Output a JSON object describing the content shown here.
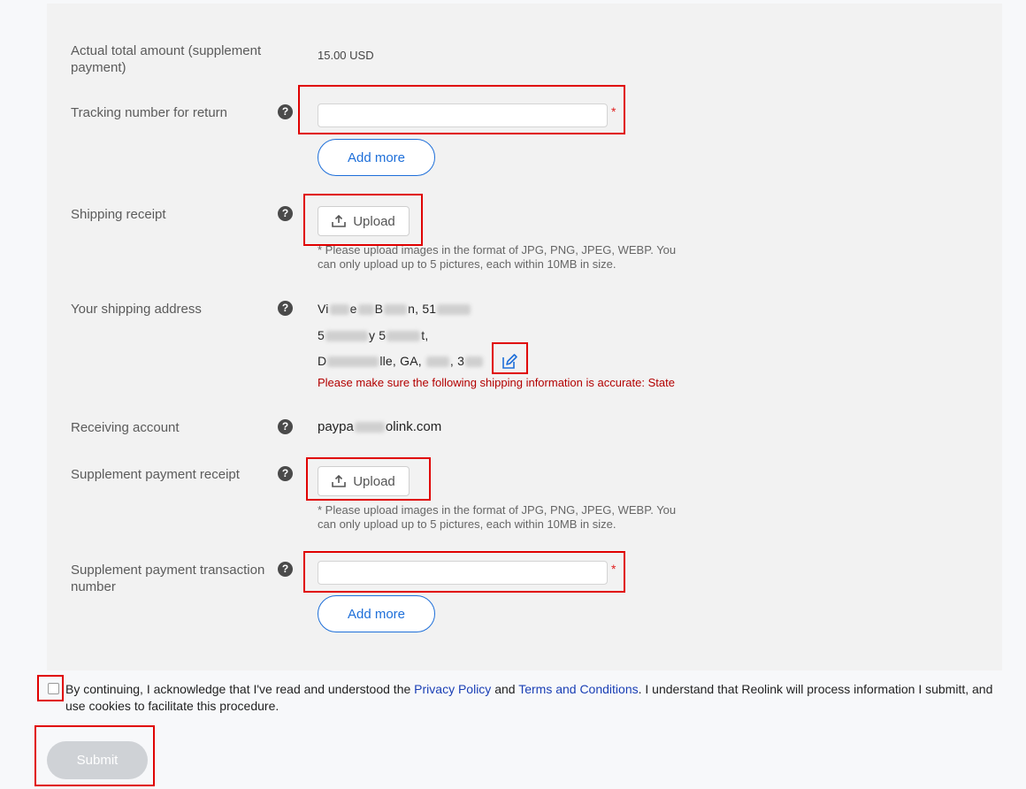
{
  "fields": {
    "actual_total": {
      "label": "Actual total amount (supplement payment)",
      "value": "15.00 USD"
    },
    "tracking": {
      "label": "Tracking number for return",
      "value": "",
      "add_more": "Add more"
    },
    "shipping_receipt": {
      "label": "Shipping receipt",
      "upload": "Upload",
      "hint": "* Please upload images in the format of JPG, PNG, JPEG, WEBP. You can only upload up to 5 pictures, each within 10MB in size."
    },
    "shipping_address": {
      "label": "Your shipping address",
      "line1_a": "Vi",
      "line1_b": "e",
      "line1_c": "B",
      "line1_d": "n, 51",
      "line2_a": "5",
      "line2_b": "y 5",
      "line2_c": "t,",
      "line3_a": "D",
      "line3_b": "lle, GA, ",
      "line3_c": ", 3",
      "warning": "Please make sure the following shipping information is accurate: State"
    },
    "receiving_account": {
      "label": "Receiving account",
      "value_a": "paypa",
      "value_b": "olink.com"
    },
    "supplement_receipt": {
      "label": "Supplement payment receipt",
      "upload": "Upload",
      "hint": "* Please upload images in the format of JPG, PNG, JPEG, WEBP. You can only upload up to 5 pictures, each within 10MB in size."
    },
    "supplement_txn": {
      "label": "Supplement payment transaction number",
      "value": "",
      "add_more": "Add more"
    }
  },
  "help_glyph": "?",
  "required_mark": "*",
  "acknowledge": {
    "checked": false,
    "text_before": "By continuing, I acknowledge that I've read and understood the ",
    "privacy_link": "Privacy Policy",
    "and": " and ",
    "terms_link": "Terms and Conditions",
    "text_after": ". I understand that Reolink will process information I submitt, and use cookies to facilitate this procedure."
  },
  "submit_label": "Submit",
  "colors": {
    "accent": "#1e6fd9",
    "highlight": "#e00000",
    "warning": "#b30000",
    "submit_disabled": "#cfd2d6"
  }
}
